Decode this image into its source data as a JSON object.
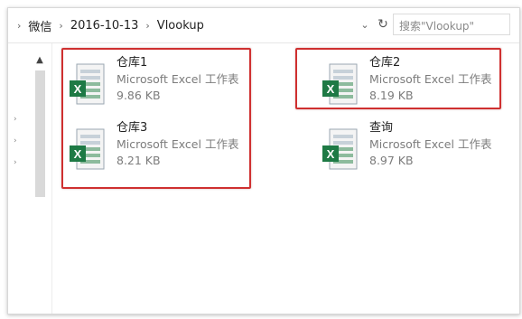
{
  "breadcrumb": [
    "微信",
    "2016-10-13",
    "Vlookup"
  ],
  "search": {
    "placeholder": "搜索\"Vlookup\""
  },
  "files": [
    {
      "name": "仓库1",
      "type": "Microsoft Excel 工作表",
      "size": "9.86 KB"
    },
    {
      "name": "仓库2",
      "type": "Microsoft Excel 工作表",
      "size": "8.19 KB"
    },
    {
      "name": "仓库3",
      "type": "Microsoft Excel 工作表",
      "size": "8.21 KB"
    },
    {
      "name": "查询",
      "type": "Microsoft Excel 工作表",
      "size": "8.97 KB"
    }
  ],
  "icons": {
    "excel_badge": "X",
    "colors": {
      "excel_green": "#1e7a45",
      "highlight": "#cf3030"
    }
  }
}
